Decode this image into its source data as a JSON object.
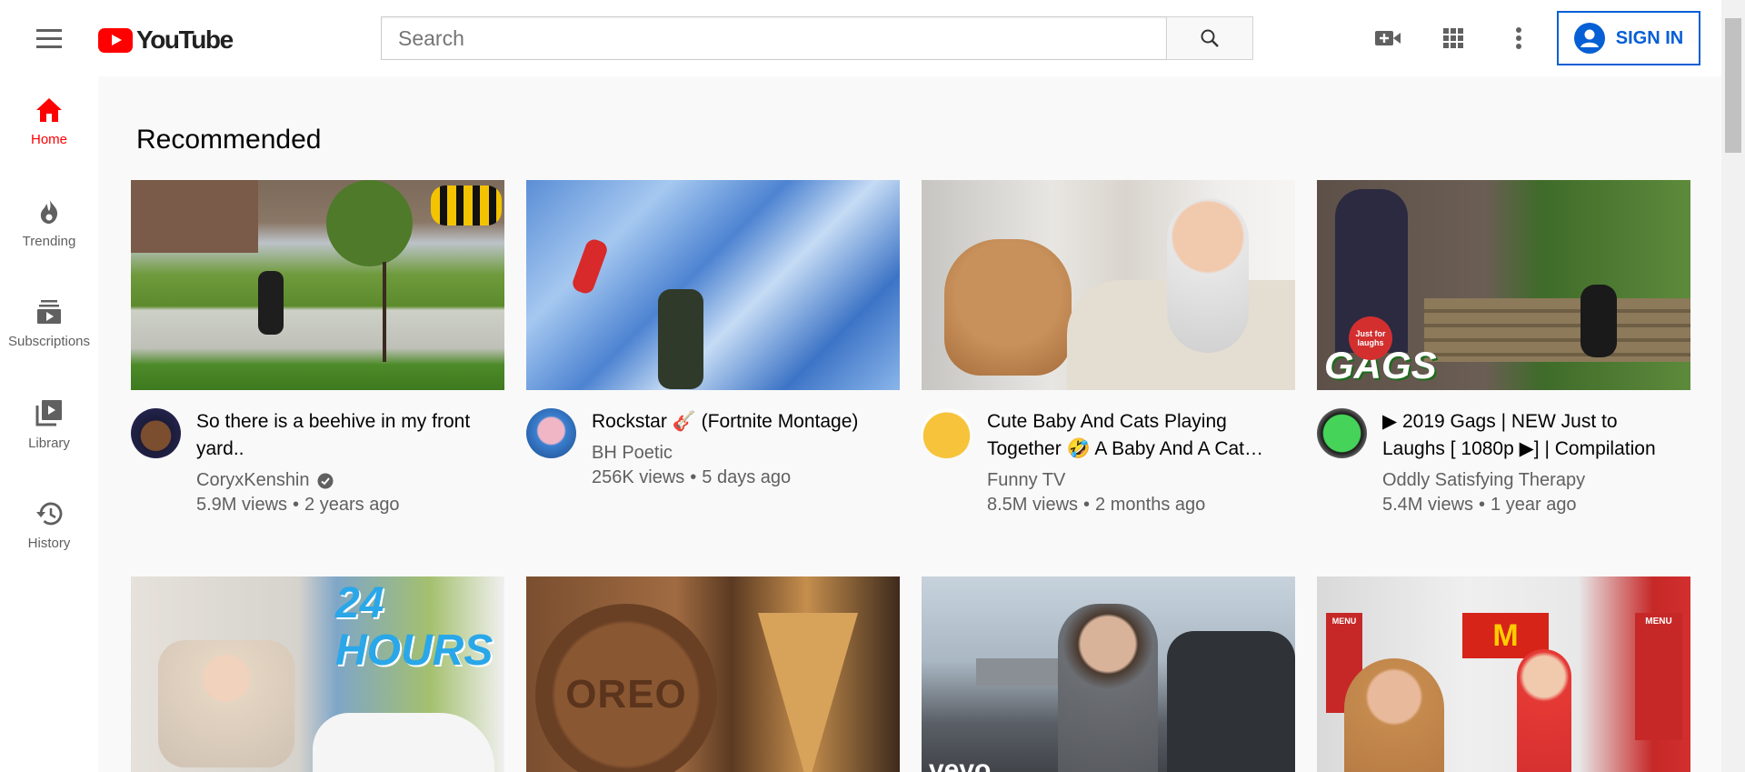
{
  "header": {
    "logo_text": "YouTube",
    "search_placeholder": "Search",
    "sign_in_label": "SIGN IN"
  },
  "sidebar": {
    "items": [
      {
        "label": "Home",
        "icon": "home-icon"
      },
      {
        "label": "Trending",
        "icon": "flame-icon"
      },
      {
        "label": "Subscriptions",
        "icon": "subscriptions-icon"
      },
      {
        "label": "Library",
        "icon": "library-icon"
      },
      {
        "label": "History",
        "icon": "history-icon"
      }
    ]
  },
  "main": {
    "section_title": "Recommended",
    "videos": [
      {
        "title": "So there is a beehive in my front yard..",
        "channel": "CoryxKenshin",
        "verified": true,
        "views": "5.9M views",
        "age": "2 years ago"
      },
      {
        "title": "Rockstar 🎸 (Fortnite Montage)",
        "channel": "BH Poetic",
        "verified": false,
        "views": "256K views",
        "age": "5 days ago"
      },
      {
        "title": "Cute Baby And Cats Playing Together 🤣 A Baby And A Cat Compilation",
        "channel": "Funny TV",
        "verified": false,
        "views": "8.5M views",
        "age": "2 months ago"
      },
      {
        "title": "▶ 2019 Gags | NEW Just to Laughs [ 1080p ▶] | Compilation",
        "channel": "Oddly Satisfying Therapy",
        "verified": false,
        "views": "5.4M views",
        "age": "1 year ago"
      }
    ],
    "thumb_text": {
      "hours": "24 HOURS",
      "oreo": "OREO",
      "vevo": "vevo",
      "gags": "GAGS",
      "jfl": "Just for laughs",
      "menu": "MENU"
    }
  }
}
